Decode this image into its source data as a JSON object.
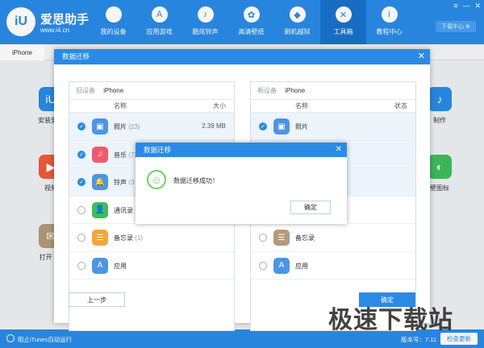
{
  "app": {
    "brand_name": "爱思助手",
    "brand_url": "www.i4.cn",
    "logo_text": "iU"
  },
  "nav": [
    {
      "label": "我的设备",
      "icon": "apple-icon",
      "glyph": ""
    },
    {
      "label": "应用游戏",
      "icon": "app-store-icon",
      "glyph": "A"
    },
    {
      "label": "酷炫铃声",
      "icon": "bell-icon",
      "glyph": "♪"
    },
    {
      "label": "高清壁纸",
      "icon": "flower-icon",
      "glyph": "✿"
    },
    {
      "label": "刷机越狱",
      "icon": "dropbox-icon",
      "glyph": "◆"
    },
    {
      "label": "工具箱",
      "icon": "tools-icon",
      "glyph": "✕",
      "active": true
    },
    {
      "label": "教程中心",
      "icon": "info-icon",
      "glyph": "i"
    }
  ],
  "window_controls": {
    "menu": "≡",
    "minimize": "—",
    "close": "✕"
  },
  "download_center": "下载中心 ⊕",
  "device_tab": "iPhone",
  "bg_tools": [
    {
      "label": "安装爱思",
      "color": "#2a8be6",
      "glyph": "iU"
    },
    {
      "label": "视频",
      "color": "#ef5b3a",
      "glyph": "▶"
    },
    {
      "label": "打开 SS",
      "color": "#b59a7a",
      "glyph": "✉"
    },
    {
      "label": "制作",
      "color": "#2a8be6",
      "glyph": "♪"
    },
    {
      "label": "壁图标",
      "color": "#3fbd5c",
      "glyph": "◐"
    }
  ],
  "dialog": {
    "title": "数据迁移",
    "close": "✕",
    "left_panel": {
      "device_label": "旧设备",
      "device_name": "iPhone",
      "col_name": "名称",
      "col_right": "大小"
    },
    "right_panel": {
      "device_label": "新设备",
      "device_name": "iPhone",
      "col_name": "名称",
      "col_right": "状态"
    },
    "left_rows": [
      {
        "label": "照片",
        "count": "(23)",
        "size": "2.39 MB",
        "checked": true,
        "color": "#4b95e8",
        "glyph": "▣",
        "icon": "photo-icon"
      },
      {
        "label": "音乐",
        "count": "(72",
        "size": "",
        "checked": true,
        "color": "#f25a6c",
        "glyph": "♫",
        "icon": "music-icon"
      },
      {
        "label": "铃声",
        "count": "(3",
        "size": "",
        "checked": true,
        "color": "#4b95e8",
        "glyph": "🔔",
        "icon": "bell-icon"
      },
      {
        "label": "通讯录",
        "count": "",
        "size": "",
        "checked": false,
        "color": "#3fbd5c",
        "glyph": "👤",
        "icon": "contacts-icon"
      },
      {
        "label": "备忘录",
        "count": "(1)",
        "size": "",
        "checked": false,
        "color": "#f3a53a",
        "glyph": "☰",
        "icon": "notes-icon"
      },
      {
        "label": "应用",
        "count": "",
        "size": "",
        "checked": false,
        "color": "#4b95e8",
        "glyph": "A",
        "icon": "app-store-icon"
      }
    ],
    "right_rows": [
      {
        "label": "照片",
        "checked": true,
        "color": "#4b95e8",
        "glyph": "▣",
        "icon": "photo-icon"
      },
      {
        "label": "",
        "checked": true,
        "color": "",
        "glyph": "",
        "icon": ""
      },
      {
        "label": "",
        "checked": true,
        "color": "",
        "glyph": "",
        "icon": ""
      },
      {
        "label": "",
        "checked": false,
        "color": "",
        "glyph": "",
        "icon": ""
      },
      {
        "label": "备忘录",
        "checked": false,
        "color": "#b59a7a",
        "glyph": "☰",
        "icon": "notes-icon"
      },
      {
        "label": "应用",
        "checked": false,
        "color": "#4b95e8",
        "glyph": "A",
        "icon": "app-store-icon"
      }
    ],
    "prev_button": "上一步",
    "confirm_button": "确定"
  },
  "popup": {
    "title": "数据迁移",
    "close": "✕",
    "message": "数据迁移成功！",
    "ok_button": "确定",
    "smiley": "☺"
  },
  "status": {
    "itunes_label": "阻止iTunes自动运行",
    "version": "版本号：7.11",
    "update_button": "检查更新"
  },
  "watermark": "极速下载站"
}
